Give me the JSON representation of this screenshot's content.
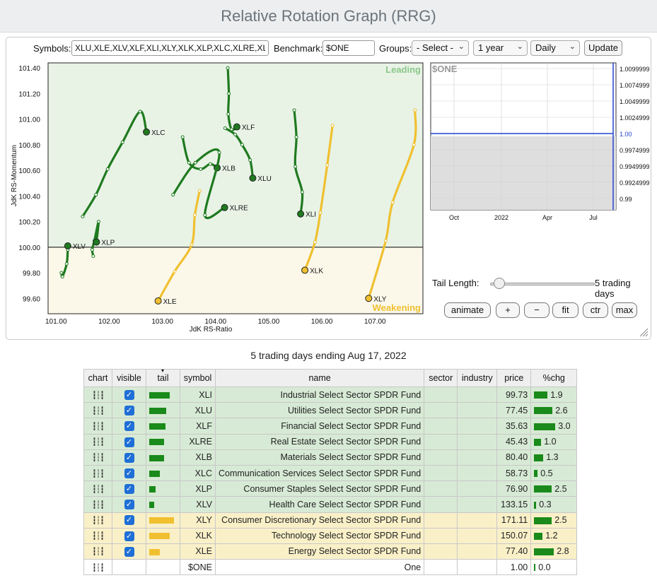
{
  "title": "Relative Rotation Graph (RRG)",
  "controls": {
    "symbols_label": "Symbols:",
    "symbols_value": "XLU,XLE,XLV,XLF,XLI,XLY,XLK,XLP,XLC,XLRE,XLB",
    "benchmark_label": "Benchmark:",
    "benchmark_value": "$ONE",
    "groups_label": "Groups:",
    "groups_value": "- Select -",
    "period_value": "1 year",
    "interval_value": "Daily",
    "update_label": "Update"
  },
  "rrg": {
    "quadrant_leading": "Leading",
    "quadrant_weakening": "Weakening",
    "xlabel": "JdK RS-Ratio",
    "ylabel": "JdK RS-Momentum",
    "x_ticks": [
      "101.00",
      "102.00",
      "103.00",
      "104.00",
      "105.00",
      "106.00",
      "107.00"
    ],
    "y_ticks": [
      "101.40",
      "101.20",
      "101.00",
      "100.80",
      "100.60",
      "100.40",
      "100.20",
      "100.00",
      "99.80",
      "99.60"
    ],
    "xlim": [
      100.85,
      107.9
    ],
    "ylim": [
      99.48,
      101.44
    ],
    "colors": {
      "leading": "#1f7a1f",
      "weakening": "#f0c030",
      "leading_bg": "#e8f3e6",
      "weakening_bg": "#fbf8ea"
    },
    "tails": [
      {
        "symbol": "XLC",
        "color": "leading",
        "points": [
          [
            101.5,
            100.24
          ],
          [
            101.75,
            100.41
          ],
          [
            101.97,
            100.61
          ],
          [
            102.25,
            100.82
          ],
          [
            102.58,
            101.06
          ],
          [
            102.7,
            100.9
          ]
        ]
      },
      {
        "symbol": "XLF",
        "color": "leading",
        "points": [
          [
            104.23,
            101.4
          ],
          [
            104.25,
            101.2
          ],
          [
            104.24,
            101.04
          ],
          [
            104.3,
            100.92
          ],
          [
            104.4,
            100.94
          ]
        ]
      },
      {
        "symbol": "XLB",
        "color": "leading",
        "points": [
          [
            103.38,
            100.86
          ],
          [
            103.5,
            100.66
          ],
          [
            103.72,
            100.61
          ],
          [
            103.9,
            100.65
          ],
          [
            104.03,
            100.62
          ]
        ]
      },
      {
        "symbol": "XLU",
        "color": "leading",
        "points": [
          [
            104.18,
            100.93
          ],
          [
            104.37,
            100.88
          ],
          [
            104.5,
            100.8
          ],
          [
            104.65,
            100.68
          ],
          [
            104.7,
            100.54
          ]
        ]
      },
      {
        "symbol": "XLRE",
        "color": "leading",
        "points": [
          [
            103.2,
            100.41
          ],
          [
            103.62,
            100.66
          ],
          [
            104.07,
            100.74
          ],
          [
            103.8,
            100.25
          ],
          [
            104.17,
            100.31
          ]
        ]
      },
      {
        "symbol": "XLI",
        "color": "leading",
        "points": [
          [
            105.48,
            101.07
          ],
          [
            105.52,
            100.86
          ],
          [
            105.5,
            100.63
          ],
          [
            105.63,
            100.43
          ],
          [
            105.6,
            100.26
          ]
        ]
      },
      {
        "symbol": "XLV",
        "color": "leading",
        "points": [
          [
            101.1,
            99.8
          ],
          [
            101.12,
            99.77
          ],
          [
            101.2,
            99.87
          ],
          [
            101.22,
            99.98
          ],
          [
            101.22,
            100.01
          ]
        ]
      },
      {
        "symbol": "XLP",
        "color": "leading",
        "points": [
          [
            101.7,
            99.93
          ],
          [
            101.68,
            99.98
          ],
          [
            101.72,
            100.05
          ],
          [
            101.8,
            100.2
          ],
          [
            101.76,
            100.04
          ]
        ]
      },
      {
        "symbol": "XLE",
        "color": "weakening",
        "points": [
          [
            103.7,
            100.44
          ],
          [
            103.61,
            100.25
          ],
          [
            103.55,
            100.02
          ],
          [
            103.23,
            99.81
          ],
          [
            102.92,
            99.58
          ]
        ]
      },
      {
        "symbol": "XLK",
        "color": "weakening",
        "points": [
          [
            106.2,
            100.95
          ],
          [
            106.1,
            100.64
          ],
          [
            105.97,
            100.27
          ],
          [
            105.87,
            100.04
          ],
          [
            105.68,
            99.82
          ]
        ]
      },
      {
        "symbol": "XLY",
        "color": "weakening",
        "points": [
          [
            107.75,
            101.07
          ],
          [
            107.73,
            100.8
          ],
          [
            107.33,
            100.35
          ],
          [
            107.2,
            100.05
          ],
          [
            106.88,
            99.6
          ]
        ]
      }
    ]
  },
  "benchmark_chart": {
    "title": "$ONE",
    "y_ticks": [
      "1.0099999",
      "1.0074999",
      "1.0049999",
      "1.0024999",
      "1.00",
      "0.9974999",
      "0.9949999",
      "0.9924999",
      "0.99"
    ],
    "x_ticks": [
      "Oct",
      "2022",
      "Apr",
      "Jul"
    ],
    "value": "1.00"
  },
  "tail_length": {
    "label": "Tail Length:",
    "value": "5 trading days",
    "days": 5
  },
  "buttons": {
    "animate": "animate",
    "plus": "+",
    "minus": "−",
    "fit": "fit",
    "ctr": "ctr",
    "max": "max"
  },
  "caption": "5 trading days ending Aug 17, 2022",
  "table": {
    "headers": [
      "chart",
      "visible",
      "tail",
      "symbol",
      "name",
      "sector",
      "industry",
      "price",
      "%chg"
    ],
    "rows": [
      {
        "symbol": "XLI",
        "name": "Industrial Select Sector SPDR Fund",
        "price": "99.73",
        "chg": "1.9",
        "tail": 29,
        "q": "lead"
      },
      {
        "symbol": "XLU",
        "name": "Utilities Select Sector SPDR Fund",
        "price": "77.45",
        "chg": "2.6",
        "tail": 24,
        "q": "lead"
      },
      {
        "symbol": "XLF",
        "name": "Financial Select Sector SPDR Fund",
        "price": "35.63",
        "chg": "3.0",
        "tail": 23,
        "q": "lead"
      },
      {
        "symbol": "XLRE",
        "name": "Real Estate Select Sector SPDR Fund",
        "price": "45.43",
        "chg": "1.0",
        "tail": 21,
        "q": "lead"
      },
      {
        "symbol": "XLB",
        "name": "Materials Select Sector SPDR Fund",
        "price": "80.40",
        "chg": "1.3",
        "tail": 21,
        "q": "lead"
      },
      {
        "symbol": "XLC",
        "name": "Communication Services Select Sector SPDR Fund",
        "price": "58.73",
        "chg": "0.5",
        "tail": 15,
        "q": "lead"
      },
      {
        "symbol": "XLP",
        "name": "Consumer Staples Select Sector SPDR Fund",
        "price": "76.90",
        "chg": "2.5",
        "tail": 9,
        "q": "lead"
      },
      {
        "symbol": "XLV",
        "name": "Health Care Select Sector SPDR Fund",
        "price": "133.15",
        "chg": "0.3",
        "tail": 7,
        "q": "lead"
      },
      {
        "symbol": "XLY",
        "name": "Consumer Discretionary Select Sector SPDR Fund",
        "price": "171.11",
        "chg": "2.5",
        "tail": 35,
        "q": "weak"
      },
      {
        "symbol": "XLK",
        "name": "Technology Select Sector SPDR Fund",
        "price": "150.07",
        "chg": "1.2",
        "tail": 29,
        "q": "weak"
      },
      {
        "symbol": "XLE",
        "name": "Energy Select Sector SPDR Fund",
        "price": "77.40",
        "chg": "2.8",
        "tail": 15,
        "q": "weak"
      },
      {
        "symbol": "$ONE",
        "name": "One",
        "price": "1.00",
        "chg": "0.0",
        "tail": 0,
        "q": "bench"
      }
    ]
  }
}
